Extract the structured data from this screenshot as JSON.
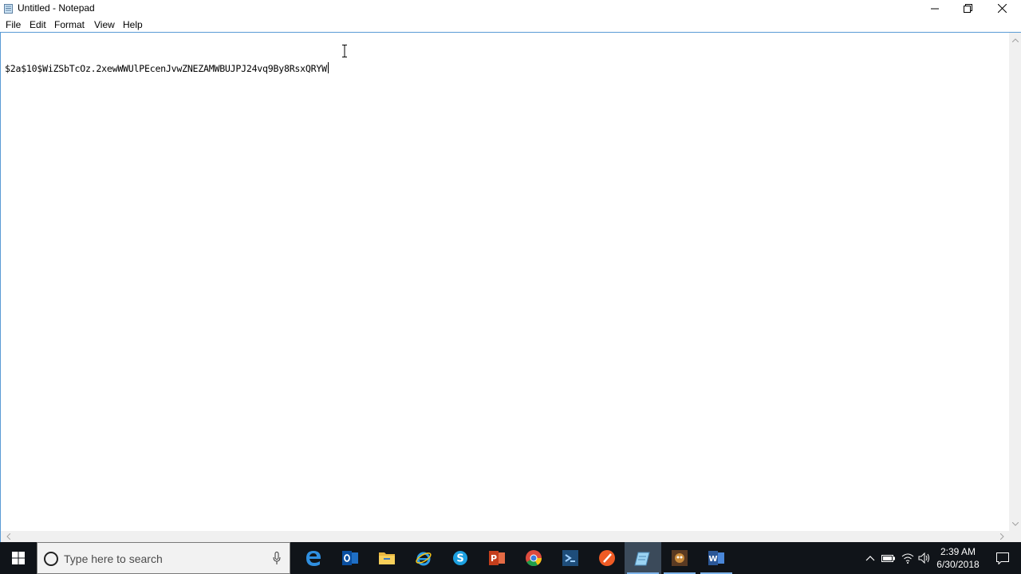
{
  "window": {
    "title": "Untitled - Notepad"
  },
  "menu": {
    "file": "File",
    "edit": "Edit",
    "format": "Format",
    "view": "View",
    "help": "Help"
  },
  "editor": {
    "content": "$2a$10$WiZSbTcOz.2xewWWUlPEcenJvwZNEZAMWBUJPJ24vq9By8RsxQRYW"
  },
  "taskbar": {
    "search_placeholder": "Type here to search",
    "pinned": [
      "Microsoft Edge",
      "Outlook",
      "File Explorer",
      "Internet Explorer",
      "Skype for Business",
      "PowerPoint",
      "Google Chrome",
      "Visual Studio Code",
      "Postman",
      "Notepad",
      "Game",
      "Word"
    ],
    "clock_time": "2:39 AM",
    "clock_date": "6/30/2018"
  },
  "colors": {
    "taskbar_bg": "#101419",
    "window_border": "#5a9bd5",
    "active_indicator": "#7eb4ea"
  }
}
